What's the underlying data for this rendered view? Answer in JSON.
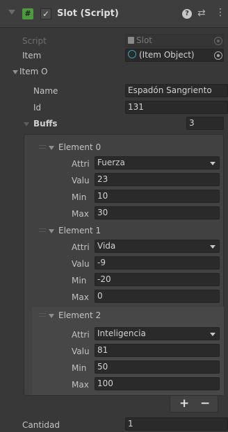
{
  "component": {
    "title": "Slot (Script)",
    "script_icon": "#",
    "enabled_check": "✓",
    "help_icon": "?",
    "preset_icon": "⇄",
    "menu_icon": "⋮"
  },
  "script_row": {
    "label": "Script",
    "value": "Slot"
  },
  "item_row": {
    "label": "Item",
    "value": "(Item Object)"
  },
  "item_o": {
    "label": "Item O",
    "name_label": "Name",
    "name_value": "Espadón Sangriento",
    "id_label": "Id",
    "id_value": "131"
  },
  "buffs": {
    "label": "Buffs",
    "size": "3",
    "elements": [
      {
        "label": "Element 0",
        "attr_label": "Attri",
        "attr": "Fuerza",
        "valu_label": "Valu",
        "valu": "23",
        "min_label": "Min",
        "min": "10",
        "max_label": "Max",
        "max": "30"
      },
      {
        "label": "Element 1",
        "attr_label": "Attri",
        "attr": "Vida",
        "valu_label": "Valu",
        "valu": "-9",
        "min_label": "Min",
        "min": "-20",
        "max_label": "Max",
        "max": "0"
      },
      {
        "label": "Element 2",
        "attr_label": "Attri",
        "attr": "Inteligencia",
        "valu_label": "Valu",
        "valu": "81",
        "min_label": "Min",
        "min": "50",
        "max_label": "Max",
        "max": "100"
      }
    ],
    "add_label": "+",
    "remove_label": "−"
  },
  "cantidad": {
    "label": "Cantidad",
    "value": "1"
  },
  "colors": {
    "background": "#383838",
    "field": "#2a2a2a",
    "script_icon": "#4d9a3e",
    "accent_link": "#3aa0b5"
  }
}
